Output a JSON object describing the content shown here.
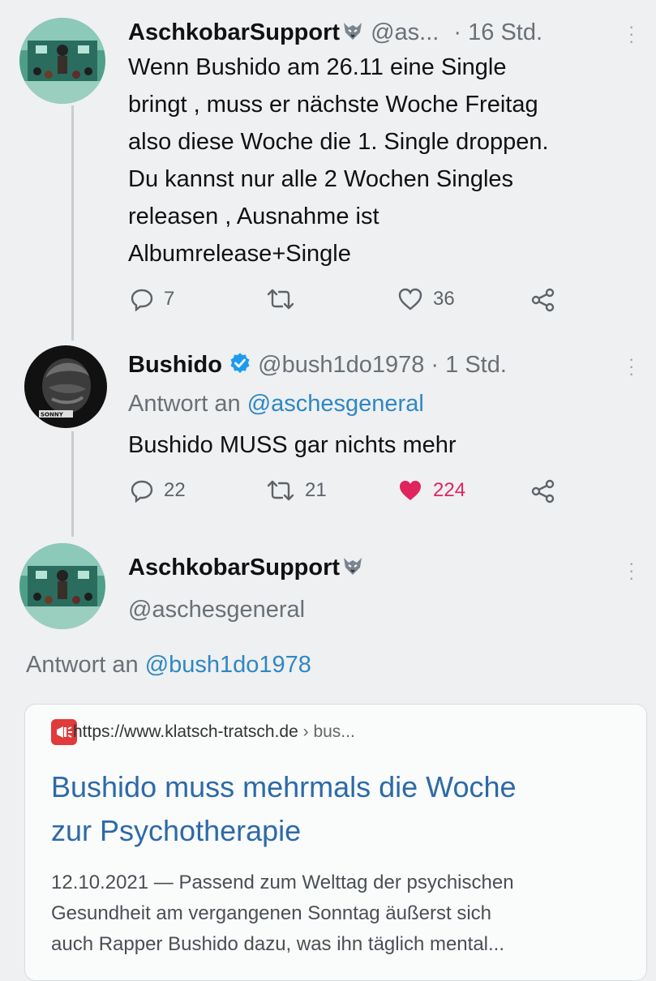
{
  "tweets": [
    {
      "name": "AschkobarSupport",
      "handle": "@as...",
      "separator": "·",
      "time": "16 Std.",
      "lines": [
        "Wenn Bushido am 26.11 eine Single",
        "bringt , muss er nächste Woche Freitag",
        "also diese Woche die 1. Single droppen.",
        "Du kannst nur alle 2 Wochen Singles",
        "releasen , Ausnahme ist",
        "Albumrelease+Single"
      ],
      "replies": "7",
      "retweets": "",
      "likes": "36"
    },
    {
      "name": "Bushido",
      "handle": "@bush1do1978",
      "separator": "·",
      "time": "1 Std.",
      "replying_prefix": "Antwort an",
      "replying_to": "@aschesgeneral",
      "text": "Bushido MUSS gar nichts mehr",
      "replies": "22",
      "retweets": "21",
      "likes": "224",
      "liked": true
    },
    {
      "name": "AschkobarSupport",
      "handle": "@aschesgeneral",
      "replying_prefix": "Antwort an",
      "replying_to": "@bush1do1978"
    }
  ],
  "link_card": {
    "url": "https://www.klatsch-tratsch.de",
    "crumb": "› bus...",
    "title_lines": [
      "Bushido muss mehrmals die Woche",
      "zur Psychotherapie"
    ],
    "snippet_lines": [
      "12.10.2021 — Passend zum Welttag der psychischen",
      "Gesundheit am vergangenen Sonntag äußerst sich",
      "auch Rapper Bushido dazu, was ihn täglich mental..."
    ]
  },
  "colors": {
    "accent": "#2f87c4",
    "like": "#e0245e",
    "link_title": "#2c6aa8"
  }
}
